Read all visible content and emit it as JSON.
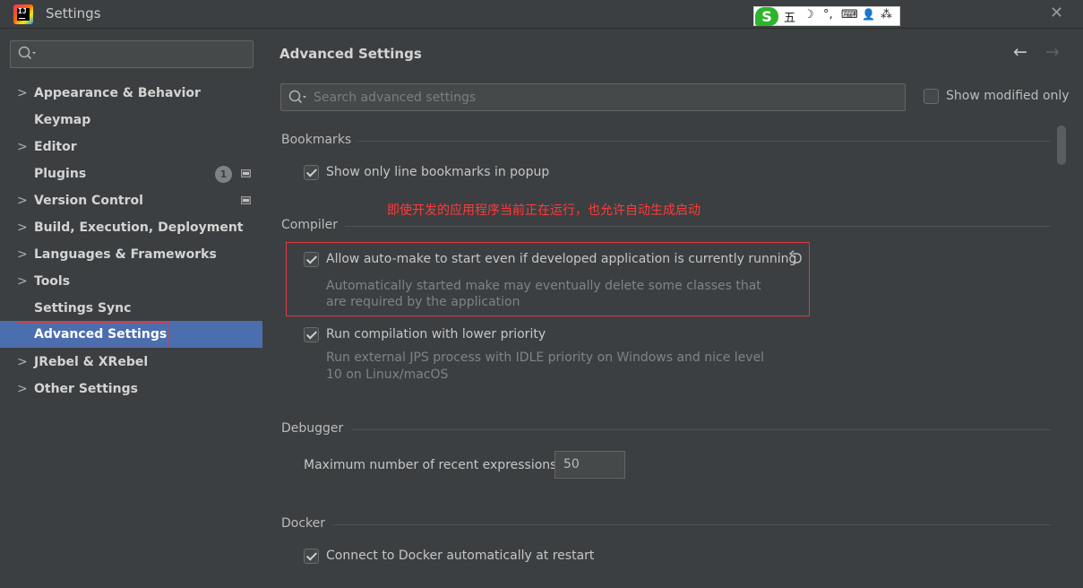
{
  "window": {
    "title": "Settings",
    "close_glyph": "✕"
  },
  "ime": {
    "logo": "S",
    "icons": [
      "五",
      "☽",
      "°,",
      "⌨",
      "👤",
      "⁂"
    ]
  },
  "sidebar": {
    "search": {
      "placeholder": ""
    },
    "items": [
      {
        "label": "Appearance & Behavior",
        "expandable": true
      },
      {
        "label": "Keymap",
        "expandable": false
      },
      {
        "label": "Editor",
        "expandable": true
      },
      {
        "label": "Plugins",
        "expandable": false,
        "badge": "1"
      },
      {
        "label": "Version Control",
        "expandable": true
      },
      {
        "label": "Build, Execution, Deployment",
        "expandable": true
      },
      {
        "label": "Languages & Frameworks",
        "expandable": true
      },
      {
        "label": "Tools",
        "expandable": true
      },
      {
        "label": "Settings Sync",
        "expandable": false
      },
      {
        "label": "Advanced Settings",
        "expandable": false,
        "selected": true
      },
      {
        "label": "JRebel & XRebel",
        "expandable": true
      },
      {
        "label": "Other Settings",
        "expandable": true
      }
    ]
  },
  "main": {
    "title": "Advanced Settings",
    "search": {
      "placeholder": "Search advanced settings"
    },
    "show_modified_only": {
      "label": "Show modified only",
      "checked": false
    },
    "annotation": "即使开发的应用程序当前正在运行，也允许自动生成启动",
    "sections": {
      "bookmarks": {
        "title": "Bookmarks",
        "opt1": {
          "label": "Show only line bookmarks in popup",
          "checked": true
        }
      },
      "compiler": {
        "title": "Compiler",
        "opt1": {
          "label": "Allow auto-make to start even if developed application is currently running",
          "checked": true,
          "desc_line1": "Automatically started make may eventually delete some classes that",
          "desc_line2": "are required by the application"
        },
        "opt2": {
          "label": "Run compilation with lower priority",
          "checked": true,
          "desc_line1": "Run external JPS process with IDLE priority on Windows and nice level",
          "desc_line2": "10 on Linux/macOS"
        }
      },
      "debugger": {
        "title": "Debugger",
        "max_expr_label": "Maximum number of recent expressions:",
        "max_expr_value": "50"
      },
      "docker": {
        "title": "Docker",
        "opt1": {
          "label": "Connect to Docker automatically at restart",
          "checked": true
        }
      }
    }
  },
  "colors": {
    "background": "#3c3f41",
    "selection": "#4b6eaf",
    "highlight_box": "#e0393e",
    "annotation_text": "#ff3a3a"
  }
}
